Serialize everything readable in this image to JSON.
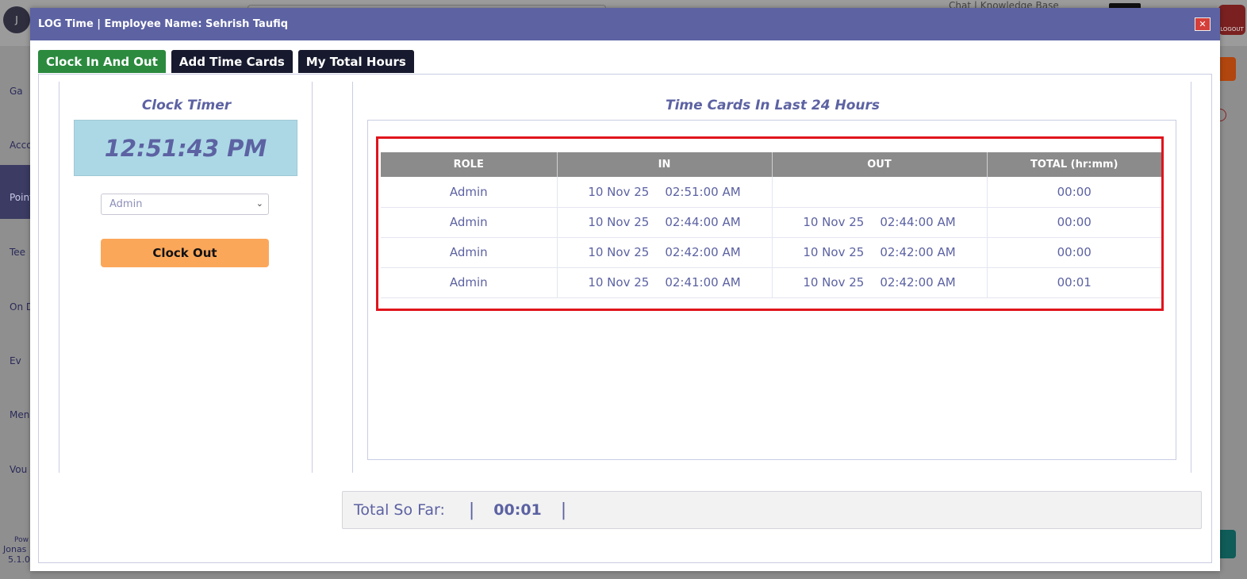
{
  "background": {
    "top_links": "Chat  |  Knowledge Base",
    "logout_label": "LOGOUT",
    "nav_items": [
      "Ga",
      "Acco",
      "Point",
      "Tee",
      "On D",
      "Ev",
      "Men",
      "Vou"
    ],
    "footer": [
      "Pow",
      "Jonas",
      "5.1.0"
    ]
  },
  "modal": {
    "title": "LOG Time | Employee Name: Sehrish Taufiq",
    "close_icon": "close-icon"
  },
  "tabs": [
    {
      "label": "Clock In And Out",
      "active": true
    },
    {
      "label": "Add Time Cards",
      "active": false
    },
    {
      "label": "My Total Hours",
      "active": false
    }
  ],
  "clock": {
    "title": "Clock Timer",
    "time": "12:51:43 PM",
    "role_selected": "Admin",
    "clock_out_label": "Clock Out"
  },
  "time_cards": {
    "title": "Time Cards In Last 24 Hours",
    "columns": [
      "ROLE",
      "IN",
      "OUT",
      "TOTAL (hr:mm)"
    ],
    "rows": [
      {
        "role": "Admin",
        "in_date": "10 Nov 25",
        "in_time": "02:51:00 AM",
        "out_date": "",
        "out_time": "",
        "total": "00:00"
      },
      {
        "role": "Admin",
        "in_date": "10 Nov 25",
        "in_time": "02:44:00 AM",
        "out_date": "10 Nov 25",
        "out_time": "02:44:00 AM",
        "total": "00:00"
      },
      {
        "role": "Admin",
        "in_date": "10 Nov 25",
        "in_time": "02:42:00 AM",
        "out_date": "10 Nov 25",
        "out_time": "02:42:00 AM",
        "total": "00:00"
      },
      {
        "role": "Admin",
        "in_date": "10 Nov 25",
        "in_time": "02:41:00 AM",
        "out_date": "10 Nov 25",
        "out_time": "02:42:00 AM",
        "total": "00:01"
      }
    ]
  },
  "total": {
    "label": "Total So Far:",
    "value": "00:01"
  },
  "colors": {
    "header": "#5c62a2",
    "active_tab": "#2b8a3e",
    "dark_tab": "#171a2e",
    "clock_box": "#acd8e6",
    "clock_out": "#fba75a",
    "highlight": "#e0141c"
  }
}
